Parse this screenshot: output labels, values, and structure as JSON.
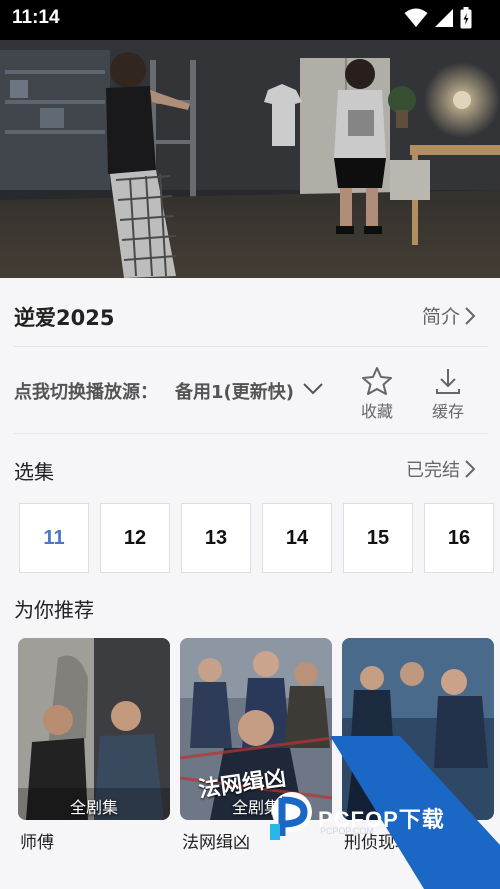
{
  "status_bar": {
    "time": "11:14",
    "icons": [
      "wifi-icon",
      "signal-icon",
      "battery-charging-icon"
    ]
  },
  "video": {
    "description_icon": "video-frame"
  },
  "drama": {
    "title": "逆爱2025",
    "intro_label": "简介"
  },
  "source": {
    "label": "点我切换播放源：",
    "value": "备用1(更新快)"
  },
  "actions": {
    "favorite_label": "收藏",
    "download_label": "缓存"
  },
  "episodes": {
    "title": "选集",
    "status": "已完结",
    "items": [
      {
        "label": "11",
        "active": true
      },
      {
        "label": "12",
        "active": false
      },
      {
        "label": "13",
        "active": false
      },
      {
        "label": "14",
        "active": false
      },
      {
        "label": "15",
        "active": false
      },
      {
        "label": "16",
        "active": false
      }
    ]
  },
  "recommend": {
    "title": "为你推荐",
    "items": [
      {
        "name": "师傅",
        "badge": "全剧集"
      },
      {
        "name": "法网缉凶",
        "badge": "全剧集",
        "poster_text": "法网缉凶"
      },
      {
        "name": "刑侦现场",
        "badge": ""
      }
    ]
  },
  "watermark": {
    "brand": "PCFOP下载",
    "sub": "PCPOP.COM"
  },
  "colors": {
    "accent": "#4a78c8",
    "background": "#f6f6f8",
    "watermark_blue": "#1a67c5"
  }
}
